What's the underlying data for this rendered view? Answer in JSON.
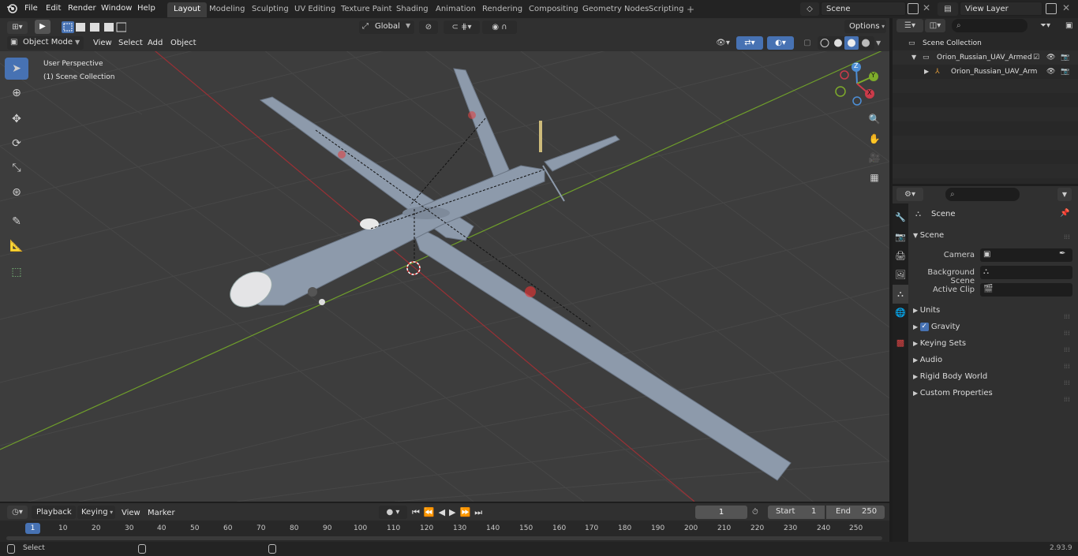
{
  "topbar": {
    "menus": [
      "File",
      "Edit",
      "Render",
      "Window",
      "Help"
    ],
    "workspaces": [
      "Layout",
      "Modeling",
      "Sculpting",
      "UV Editing",
      "Texture Paint",
      "Shading",
      "Animation",
      "Rendering",
      "Compositing",
      "Geometry Nodes",
      "Scripting"
    ],
    "active_workspace": "Layout",
    "add_tab": "+",
    "scene_name": "Scene",
    "view_layer": "View Layer"
  },
  "viewport_header": {
    "mode": "Object Mode",
    "menus": [
      "View",
      "Select",
      "Add",
      "Object"
    ],
    "transform_orientation": "Global",
    "options_label": "Options"
  },
  "viewport": {
    "perspective_label": "User Perspective",
    "collection_label": "(1) Scene Collection",
    "gizmo_axes": {
      "z": "Z",
      "y": "Y",
      "x": "X"
    }
  },
  "outliner": {
    "root": "Scene Collection",
    "items": [
      {
        "name": "Orion_Russian_UAV_Armed"
      },
      {
        "name": "Orion_Russian_UAV_Arm"
      }
    ]
  },
  "properties": {
    "context_title": "Scene",
    "section_title": "Scene",
    "fields": [
      {
        "label": "Camera",
        "value": ""
      },
      {
        "label": "Background Scene",
        "value": ""
      },
      {
        "label": "Active Clip",
        "value": ""
      }
    ],
    "panels": [
      "Units",
      "Gravity",
      "Keying Sets",
      "Audio",
      "Rigid Body World",
      "Custom Properties"
    ],
    "gravity_checked": true
  },
  "timeline": {
    "menus": [
      "Playback",
      "Keying",
      "View",
      "Marker"
    ],
    "current_frame": "1",
    "start_label": "Start",
    "start_value": "1",
    "end_label": "End",
    "end_value": "250",
    "ticks": [
      "10",
      "20",
      "30",
      "40",
      "50",
      "60",
      "70",
      "80",
      "90",
      "100",
      "110",
      "120",
      "130",
      "140",
      "150",
      "160",
      "170",
      "180",
      "190",
      "200",
      "210",
      "220",
      "230",
      "240",
      "250"
    ],
    "playhead_label": "1"
  },
  "statusbar": {
    "left_label": "Select",
    "version": "2.93.9"
  },
  "colors": {
    "accent": "#4772b3",
    "grid_bg": "#3d3d3d",
    "x_axis": "#b0323a",
    "y_axis": "#6f9e2b"
  }
}
